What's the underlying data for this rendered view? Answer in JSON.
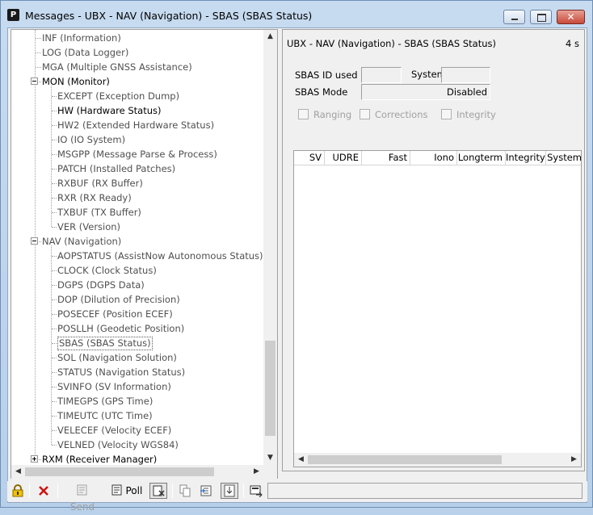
{
  "window": {
    "app_icon": "P",
    "title": "Messages - UBX - NAV (Navigation) - SBAS (SBAS Status)",
    "minimize_icon": "minimize-icon",
    "maximize_icon": "maximize-icon",
    "close_icon": "close-icon",
    "close_glyph": "✕"
  },
  "tree": {
    "items": [
      {
        "label": "INF (Information)",
        "level": 1,
        "type": "leaf"
      },
      {
        "label": "LOG (Data Logger)",
        "level": 1,
        "type": "leaf"
      },
      {
        "label": "MGA (Multiple GNSS Assistance)",
        "level": 1,
        "type": "leaf"
      },
      {
        "label": "MON (Monitor)",
        "level": 1,
        "type": "expanded"
      },
      {
        "label": "EXCEPT (Exception Dump)",
        "level": 2,
        "type": "leaf"
      },
      {
        "label": "HW (Hardware Status)",
        "level": 2,
        "type": "leaf",
        "dark": true
      },
      {
        "label": "HW2 (Extended Hardware Status)",
        "level": 2,
        "type": "leaf"
      },
      {
        "label": "IO (IO System)",
        "level": 2,
        "type": "leaf"
      },
      {
        "label": "MSGPP (Message Parse & Process)",
        "level": 2,
        "type": "leaf"
      },
      {
        "label": "PATCH (Installed Patches)",
        "level": 2,
        "type": "leaf"
      },
      {
        "label": "RXBUF (RX Buffer)",
        "level": 2,
        "type": "leaf"
      },
      {
        "label": "RXR (RX Ready)",
        "level": 2,
        "type": "leaf"
      },
      {
        "label": "TXBUF (TX Buffer)",
        "level": 2,
        "type": "leaf"
      },
      {
        "label": "VER (Version)",
        "level": 2,
        "type": "leaf"
      },
      {
        "label": "NAV (Navigation)",
        "level": 1,
        "type": "expanded-grey"
      },
      {
        "label": "AOPSTATUS (AssistNow Autonomous Status)",
        "level": 2,
        "type": "leaf"
      },
      {
        "label": "CLOCK (Clock Status)",
        "level": 2,
        "type": "leaf"
      },
      {
        "label": "DGPS (DGPS Data)",
        "level": 2,
        "type": "leaf"
      },
      {
        "label": "DOP (Dilution of Precision)",
        "level": 2,
        "type": "leaf"
      },
      {
        "label": "POSECEF (Position ECEF)",
        "level": 2,
        "type": "leaf"
      },
      {
        "label": "POSLLH (Geodetic Position)",
        "level": 2,
        "type": "leaf"
      },
      {
        "label": "SBAS (SBAS Status)",
        "level": 2,
        "type": "leaf",
        "selected": true
      },
      {
        "label": "SOL (Navigation Solution)",
        "level": 2,
        "type": "leaf"
      },
      {
        "label": "STATUS (Navigation Status)",
        "level": 2,
        "type": "leaf"
      },
      {
        "label": "SVINFO (SV Information)",
        "level": 2,
        "type": "leaf"
      },
      {
        "label": "TIMEGPS (GPS Time)",
        "level": 2,
        "type": "leaf"
      },
      {
        "label": "TIMEUTC (UTC Time)",
        "level": 2,
        "type": "leaf"
      },
      {
        "label": "VELECEF (Velocity ECEF)",
        "level": 2,
        "type": "leaf"
      },
      {
        "label": "VELNED (Velocity WGS84)",
        "level": 2,
        "type": "leaf"
      },
      {
        "label": "RXM (Receiver Manager)",
        "level": 1,
        "type": "collapsed"
      }
    ],
    "scroll_up": "▲",
    "scroll_down": "▼",
    "scroll_left": "◀",
    "scroll_right": "▶"
  },
  "panel": {
    "title": "UBX - NAV (Navigation) - SBAS (SBAS Status)",
    "age": "4 s",
    "sbas_id_label": "SBAS ID used",
    "sbas_id_value": "",
    "system_label": "System",
    "system_value": "",
    "sbas_mode_label": "SBAS Mode",
    "sbas_mode_value": "Disabled",
    "checkboxes": {
      "ranging": "Ranging",
      "corrections": "Corrections",
      "integrity": "Integrity"
    },
    "table": {
      "columns": [
        "SV",
        "UDRE",
        "Fast",
        "Iono",
        "Longterm",
        "Integrity",
        "System"
      ],
      "rows": []
    }
  },
  "toolbar": {
    "send_label": "Send",
    "poll_label": "Poll",
    "lock_icon": "lock-icon",
    "delete_icon": "delete-icon",
    "send_icon": "send-icon",
    "poll_icon": "poll-icon"
  },
  "colors": {
    "window_frame": "#b9d1ea",
    "close_button": "#c74a3a",
    "disabled_text": "#a0a0a0"
  }
}
